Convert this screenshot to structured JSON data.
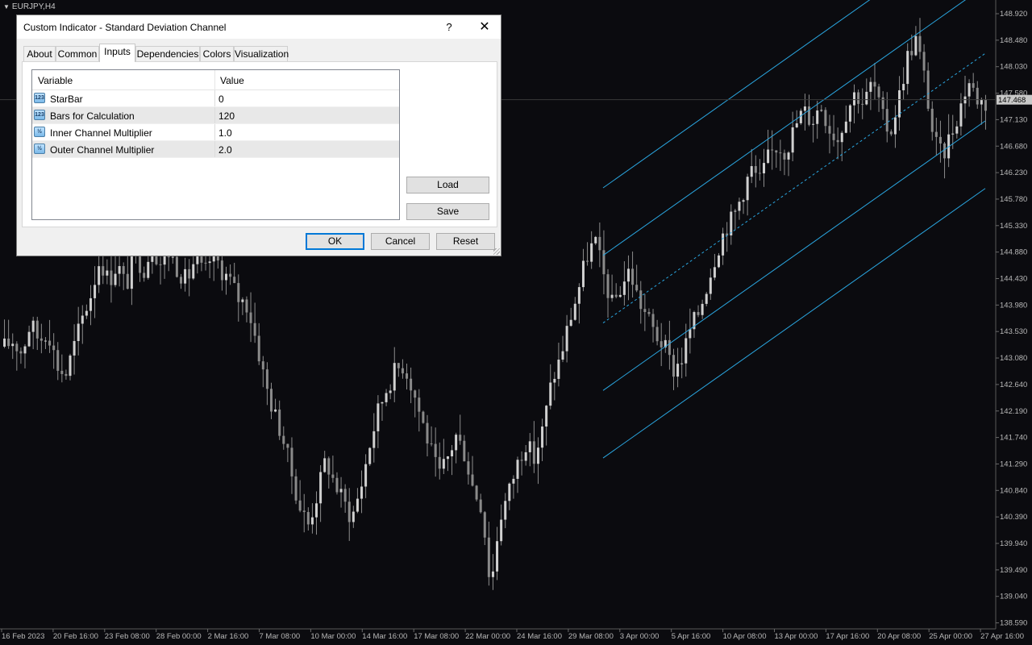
{
  "window": {
    "symbol": "EURJPY,H4",
    "dialog_title": "Custom Indicator - Standard Deviation Channel",
    "help_label": "?",
    "close_label": "✕"
  },
  "tabs": [
    "About",
    "Common",
    "Inputs",
    "Dependencies",
    "Colors",
    "Visualization"
  ],
  "active_tab": "Inputs",
  "inputs_table": {
    "headers": {
      "variable": "Variable",
      "value": "Value"
    },
    "rows": [
      {
        "icon": "integer-icon",
        "icon_text": "123",
        "variable": "StarBar",
        "value": "0"
      },
      {
        "icon": "integer-icon",
        "icon_text": "123",
        "variable": "Bars for Calculation",
        "value": "120"
      },
      {
        "icon": "double-icon",
        "icon_text": "½",
        "variable": "Inner Channel Multiplier",
        "value": "1.0"
      },
      {
        "icon": "double-icon",
        "icon_text": "½",
        "variable": "Outer Channel Multiplier",
        "value": "2.0"
      }
    ]
  },
  "buttons": {
    "load": "Load",
    "save": "Save",
    "ok": "OK",
    "cancel": "Cancel",
    "reset": "Reset"
  },
  "chart_data": {
    "type": "candlestick",
    "symbol": "EURJPY",
    "timeframe": "H4",
    "current_price": "147.468",
    "y_ticks": [
      "148.920",
      "148.480",
      "148.030",
      "147.580",
      "147.130",
      "146.680",
      "146.230",
      "145.780",
      "145.330",
      "144.880",
      "144.430",
      "143.980",
      "143.530",
      "143.080",
      "142.640",
      "142.190",
      "141.740",
      "141.290",
      "140.840",
      "140.390",
      "139.940",
      "139.490",
      "139.040",
      "138.590"
    ],
    "x_ticks": [
      "16 Feb 2023",
      "20 Feb 16:00",
      "23 Feb 08:00",
      "28 Feb 00:00",
      "2 Mar 16:00",
      "7 Mar 08:00",
      "10 Mar 00:00",
      "14 Mar 16:00",
      "17 Mar 08:00",
      "22 Mar 00:00",
      "24 Mar 16:00",
      "29 Mar 08:00",
      "3 Apr 00:00",
      "5 Apr 16:00",
      "10 Apr 08:00",
      "13 Apr 00:00",
      "17 Apr 16:00",
      "20 Apr 08:00",
      "25 Apr 00:00",
      "27 Apr 16:00"
    ],
    "ylim": [
      138.59,
      148.92
    ],
    "price_path": [
      143.3,
      143.4,
      143.2,
      143.7,
      143.4,
      143.6,
      143.0,
      142.8,
      143.3,
      143.8,
      144.2,
      144.8,
      144.4,
      144.7,
      144.3,
      144.9,
      144.6,
      145.0,
      144.7,
      144.9,
      144.6,
      144.4,
      144.8,
      144.5,
      144.9,
      144.6,
      144.4,
      144.1,
      144.0,
      143.4,
      142.7,
      142.2,
      141.8,
      141.2,
      140.6,
      140.3,
      140.8,
      141.4,
      141.0,
      140.7,
      140.4,
      140.9,
      141.6,
      142.2,
      142.6,
      142.9,
      143.0,
      142.6,
      142.1,
      141.6,
      141.1,
      141.4,
      141.8,
      141.5,
      140.9,
      140.6,
      139.2,
      140.4,
      140.8,
      141.3,
      141.7,
      141.4,
      141.9,
      142.7,
      143.1,
      143.7,
      144.2,
      144.8,
      145.1,
      144.5,
      144.0,
      144.3,
      144.6,
      144.1,
      143.8,
      143.5,
      143.3,
      142.9,
      143.1,
      143.6,
      143.9,
      144.4,
      144.9,
      145.3,
      145.5,
      145.9,
      146.3,
      146.1,
      146.5,
      146.7,
      146.6,
      147.0,
      147.3,
      147.1,
      147.4,
      147.0,
      146.8,
      147.3,
      147.6,
      147.4,
      147.8,
      147.2,
      146.9,
      147.5,
      148.2,
      148.5,
      147.8,
      146.8,
      146.5,
      146.9,
      147.3,
      147.8,
      147.5,
      147.4
    ]
  }
}
